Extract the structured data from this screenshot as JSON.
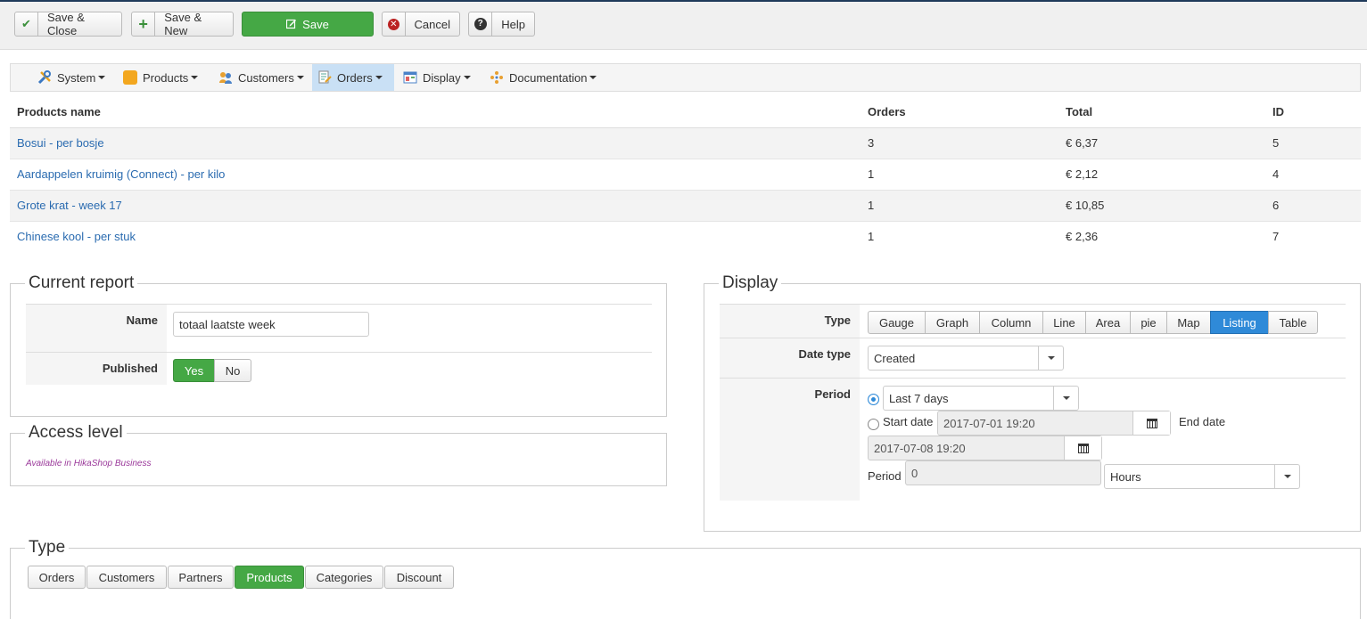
{
  "toolbar": {
    "save_close": "Save & Close",
    "save_new": "Save & New",
    "save": "Save",
    "cancel": "Cancel",
    "help": "Help"
  },
  "menu": [
    {
      "label": "System",
      "icon": "tools-icon"
    },
    {
      "label": "Products",
      "icon": "box-icon"
    },
    {
      "label": "Customers",
      "icon": "users-icon"
    },
    {
      "label": "Orders",
      "icon": "orders-icon"
    },
    {
      "label": "Display",
      "icon": "display-icon"
    },
    {
      "label": "Documentation",
      "icon": "documentation-icon"
    }
  ],
  "table": {
    "headers": [
      "Products name",
      "Orders",
      "Total",
      "ID"
    ],
    "rows": [
      {
        "name": "Bosui - per bosje",
        "orders": "3",
        "total": "€ 6,37",
        "id": "5"
      },
      {
        "name": "Aardappelen kruimig (Connect) - per kilo",
        "orders": "1",
        "total": "€ 2,12",
        "id": "4"
      },
      {
        "name": "Grote krat - week 17",
        "orders": "1",
        "total": "€ 10,85",
        "id": "6"
      },
      {
        "name": "Chinese kool - per stuk",
        "orders": "1",
        "total": "€ 2,36",
        "id": "7"
      }
    ]
  },
  "current_report": {
    "legend": "Current report",
    "name_label": "Name",
    "name_value": "totaal laatste week",
    "published_label": "Published",
    "yes": "Yes",
    "no": "No",
    "published_selected": "Yes"
  },
  "access_level": {
    "legend": "Access level",
    "note": "Available in HikaShop Business"
  },
  "display": {
    "legend": "Display",
    "type_label": "Type",
    "types": [
      "Gauge",
      "Graph",
      "Column",
      "Line",
      "Area",
      "pie",
      "Map",
      "Listing",
      "Table"
    ],
    "type_selected": "Listing",
    "date_type_label": "Date type",
    "date_type_value": "Created",
    "period_label": "Period",
    "period_value": "Last 7 days",
    "start_date_label": "Start date",
    "start_date_value": "2017-07-01 19:20",
    "end_date_label": "End date",
    "end_date_value": "2017-07-08 19:20",
    "period_field_label": "Period",
    "period_field_value": "0",
    "period_unit": "Hours"
  },
  "type_section": {
    "legend": "Type",
    "options": [
      "Orders",
      "Customers",
      "Partners",
      "Products",
      "Categories",
      "Discount"
    ],
    "selected": "Products"
  },
  "colors": {
    "green": "#45a845",
    "blue": "#2f8ad8",
    "link": "#2a6bb0",
    "active_menu": "#c9e0f5"
  }
}
